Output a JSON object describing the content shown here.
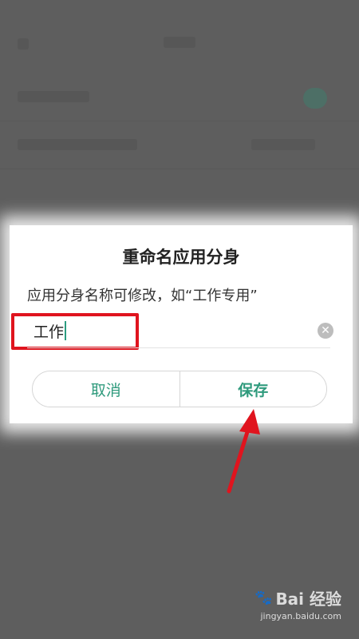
{
  "dialog": {
    "title": "重命名应用分身",
    "description": "应用分身名称可修改，如“工作专用”",
    "input_value": "工作",
    "cancel_label": "取消",
    "save_label": "保存"
  },
  "icons": {
    "clear": "clear-circle-icon",
    "annotation_arrow": "red-arrow"
  },
  "colors": {
    "accent": "#2e9a7c",
    "annotation_red": "#e0141e",
    "overlay": "#5e5e5e"
  },
  "watermark": {
    "brand": "Bai 经验",
    "url": "jingyan.baidu.com"
  }
}
